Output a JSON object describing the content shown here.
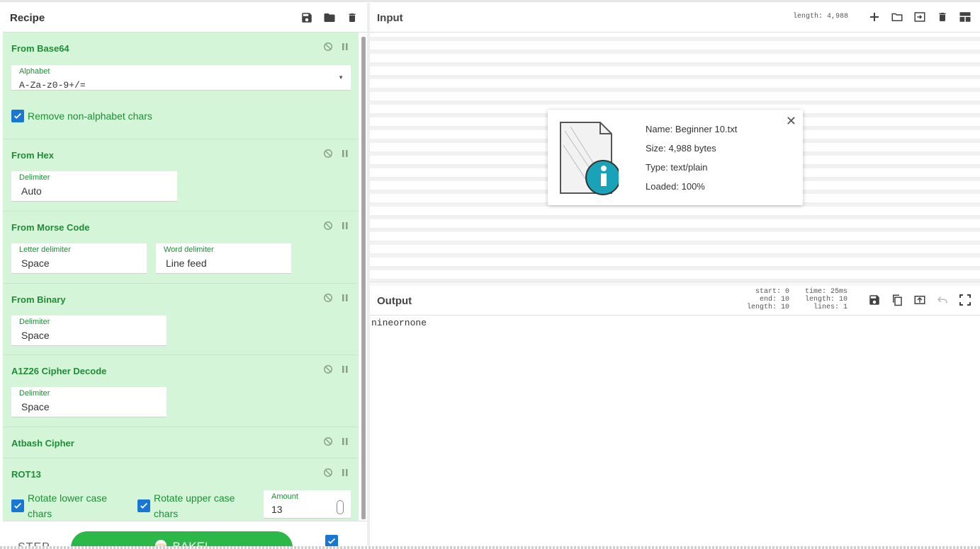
{
  "recipe": {
    "title": "Recipe",
    "operations": [
      {
        "name": "From Base64",
        "fields": [
          {
            "label": "Alphabet",
            "value": "A-Za-z0-9+/="
          }
        ],
        "checkbox": "Remove non-alphabet chars"
      },
      {
        "name": "From Hex",
        "fields": [
          {
            "label": "Delimiter",
            "value": "Auto"
          }
        ]
      },
      {
        "name": "From Morse Code",
        "fields": [
          {
            "label": "Letter delimiter",
            "value": "Space"
          },
          {
            "label": "Word delimiter",
            "value": "Line feed"
          }
        ]
      },
      {
        "name": "From Binary",
        "fields": [
          {
            "label": "Delimiter",
            "value": "Space"
          }
        ]
      },
      {
        "name": "A1Z26 Cipher Decode",
        "fields": [
          {
            "label": "Delimiter",
            "value": "Space"
          }
        ]
      },
      {
        "name": "Atbash Cipher"
      },
      {
        "name": "ROT13",
        "checkboxes": [
          "Rotate lower case chars",
          "Rotate upper case chars"
        ],
        "amount_label": "Amount",
        "amount": "13"
      }
    ],
    "step_label": "STEP",
    "bake_label": "BAKE!"
  },
  "input": {
    "title": "Input",
    "length": "length: 4,988"
  },
  "file": {
    "name": "Name: Beginner 10.txt",
    "size": "Size: 4,988 bytes",
    "type": "Type: text/plain",
    "loaded": "Loaded: 100%"
  },
  "output": {
    "title": "Output",
    "start": "start: 0",
    "end": "end: 10",
    "length": "length: 10",
    "time": "time: 25ms",
    "olength": "length: 10",
    "lines": "lines: 1",
    "text": "nineornone"
  },
  "colors": {
    "accent": "#1976d2",
    "op_bg": "#d5f5d9",
    "op_text": "#1e8d36",
    "bake": "#2cb848"
  }
}
